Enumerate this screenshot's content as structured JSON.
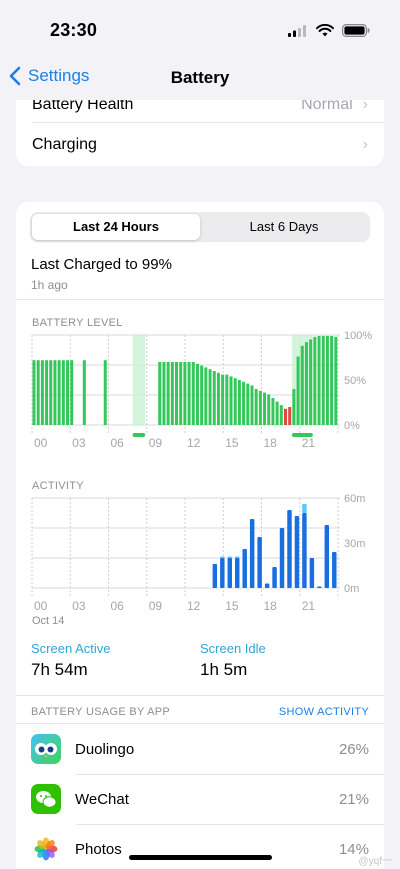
{
  "status": {
    "time": "23:30"
  },
  "nav": {
    "back_label": "Settings",
    "title": "Battery"
  },
  "top_card": {
    "health_label": "Battery Health",
    "health_value": "Normal",
    "charging_label": "Charging"
  },
  "segmented": {
    "tab1": "Last 24 Hours",
    "tab2": "Last 6 Days",
    "active": 0
  },
  "last_charged": {
    "title": "Last Charged to 99%",
    "subtitle": "1h ago"
  },
  "battery_level": {
    "label": "BATTERY LEVEL",
    "y_ticks": [
      "100%",
      "50%",
      "0%"
    ],
    "x_ticks": [
      "00",
      "03",
      "06",
      "09",
      "12",
      "15",
      "18",
      "21"
    ]
  },
  "activity": {
    "label": "ACTIVITY",
    "y_ticks": [
      "60m",
      "30m",
      "0m"
    ],
    "x_ticks": [
      "00",
      "03",
      "06",
      "09",
      "12",
      "15",
      "18",
      "21"
    ],
    "date_label": "Oct 14"
  },
  "totals": {
    "screen_active_label": "Screen Active",
    "screen_active_value": "7h 54m",
    "screen_idle_label": "Screen Idle",
    "screen_idle_value": "1h 5m"
  },
  "usage": {
    "header": "BATTERY USAGE BY APP",
    "action": "SHOW ACTIVITY",
    "apps": [
      {
        "name": "Duolingo",
        "pct": "26%"
      },
      {
        "name": "WeChat",
        "pct": "21%"
      },
      {
        "name": "Photos",
        "pct": "14%"
      }
    ]
  },
  "watermark": "@yqf一",
  "colors": {
    "accent_blue": "#1a7fe8",
    "battery_green": "#34c759",
    "battery_low_red": "#e0483e",
    "activity_blue": "#1a6fe0",
    "idle_light_blue": "#5ac8fa"
  },
  "chart_data": [
    {
      "type": "bar",
      "title": "BATTERY LEVEL",
      "ylim": [
        0,
        100
      ],
      "x_tick_labels": [
        "00",
        "03",
        "06",
        "09",
        "12",
        "15",
        "18",
        "21"
      ],
      "series": [
        {
          "values": [
            72,
            72,
            72,
            72,
            72,
            72,
            72,
            72,
            72,
            72,
            0,
            0,
            72,
            0,
            0,
            0,
            0,
            72,
            0,
            0,
            0,
            0,
            0,
            0,
            0,
            0,
            0,
            0,
            0,
            0,
            70,
            70,
            70,
            70,
            70,
            70,
            70,
            70,
            70,
            68,
            66,
            64,
            62,
            60,
            58,
            56,
            56,
            54,
            52,
            50,
            48,
            46,
            44,
            40,
            38,
            36,
            34,
            30,
            26,
            22,
            18,
            20,
            40,
            76,
            88,
            92,
            95,
            98,
            99,
            99,
            99,
            99,
            98
          ],
          "charging_segments": [
            [
              24,
              26
            ],
            [
              62,
              66
            ]
          ]
        }
      ]
    },
    {
      "type": "bar",
      "title": "ACTIVITY",
      "ylim": [
        0,
        60
      ],
      "x_tick_labels": [
        "00",
        "03",
        "06",
        "09",
        "12",
        "15",
        "18",
        "21"
      ],
      "series": [
        {
          "name": "Screen Active",
          "values": [
            0,
            0,
            0,
            0,
            0,
            0,
            0,
            0,
            0,
            0,
            0,
            0,
            0,
            0,
            0,
            0,
            0,
            0,
            0,
            0,
            0,
            0,
            0,
            0,
            16,
            20,
            20,
            20,
            26,
            46,
            34,
            3,
            14,
            40,
            52,
            48,
            50,
            20,
            1,
            42,
            24
          ]
        },
        {
          "name": "Screen Idle",
          "values": [
            0,
            0,
            0,
            0,
            0,
            0,
            0,
            0,
            0,
            0,
            0,
            0,
            0,
            0,
            0,
            0,
            0,
            0,
            0,
            0,
            0,
            0,
            0,
            0,
            0,
            1,
            1,
            1,
            0,
            0,
            0,
            0,
            0,
            0,
            0,
            0,
            6,
            0,
            0,
            0,
            0
          ]
        }
      ]
    }
  ]
}
